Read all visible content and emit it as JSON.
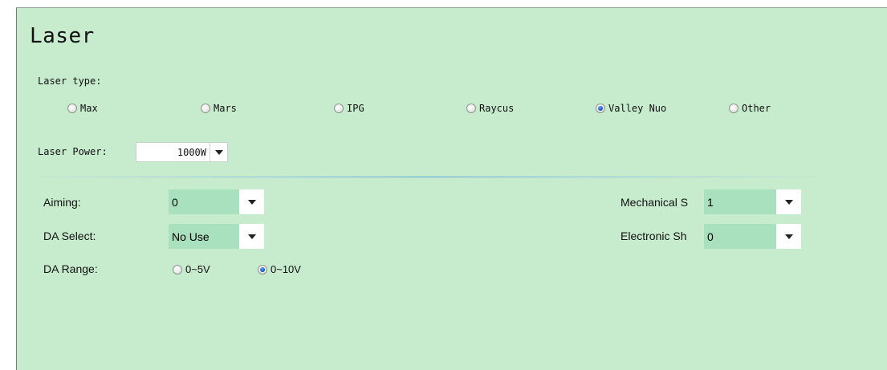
{
  "section": {
    "title": "Laser"
  },
  "laser_type": {
    "label": "Laser type:",
    "options": [
      {
        "label": "Max",
        "checked": false
      },
      {
        "label": "Mars",
        "checked": false
      },
      {
        "label": "IPG",
        "checked": false
      },
      {
        "label": "Raycus",
        "checked": false
      },
      {
        "label": "Valley Nuo",
        "checked": true
      },
      {
        "label": "Other",
        "checked": false
      }
    ]
  },
  "laser_power": {
    "label": "Laser Power:",
    "value": "1000W"
  },
  "aiming": {
    "label": "Aiming:",
    "value": "0"
  },
  "da_select": {
    "label": "DA Select:",
    "value": "No Use"
  },
  "da_range": {
    "label": "DA Range:",
    "options": [
      {
        "label": "0~5V",
        "checked": false
      },
      {
        "label": "0~10V",
        "checked": true
      }
    ]
  },
  "mechanical_shutter": {
    "label": "Mechanical S",
    "value": "1"
  },
  "electronic_shutter": {
    "label": "Electronic Sh",
    "value": "0"
  },
  "colors": {
    "panel_bg": "#c7ebcd",
    "combo_bg": "#a9e0bd",
    "radio_checked": "#1d55c4"
  }
}
